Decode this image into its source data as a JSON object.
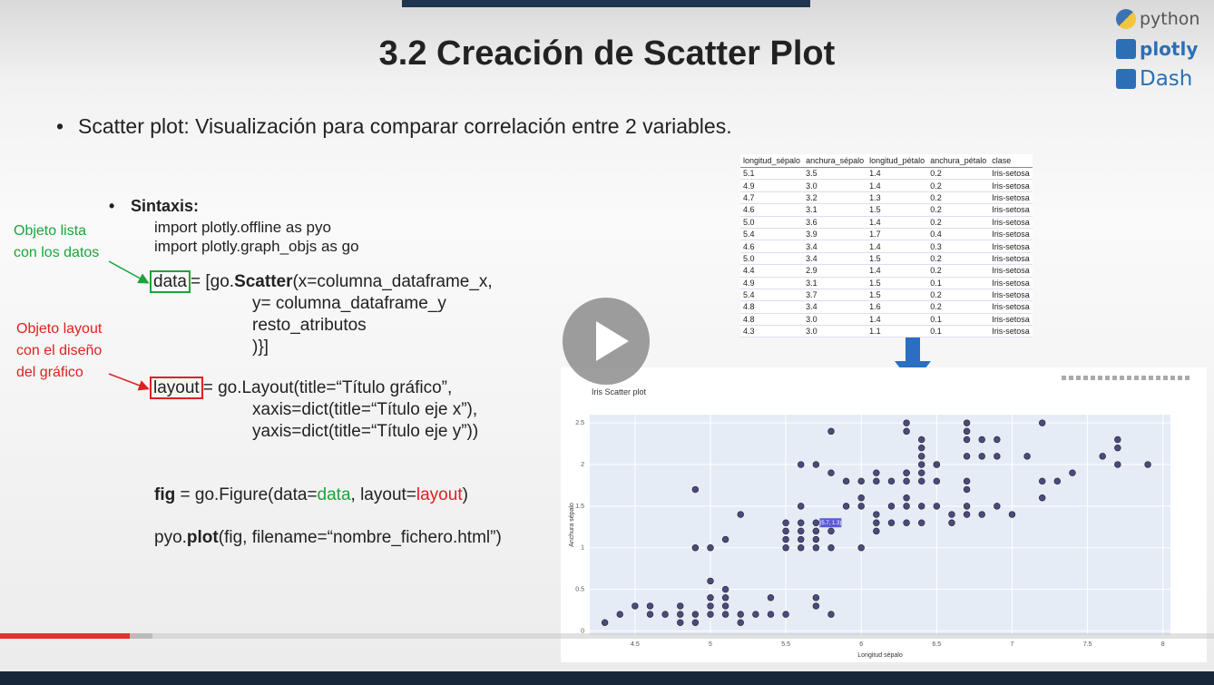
{
  "slide": {
    "title": "3.2 Creación de Scatter Plot",
    "bullet1": "Scatter plot: Visualización para comparar correlación entre 2 variables.",
    "bullet2": "Sintaxis:",
    "code_import1": "import plotly.offline as pyo",
    "code_import2": "import plotly.graph_objs as go",
    "data_kw": "data",
    "data_line1_a": "= [go.",
    "data_line1_b": "Scatter",
    "data_line1_c": "(x=columna_dataframe_x,",
    "data_line2": "y= columna_dataframe_y",
    "data_line3": "resto_atributos",
    "data_line4": ")}]",
    "layout_kw": "layout",
    "layout_line1": "= go.Layout(title=“Título gráfico”,",
    "layout_line2": "xaxis=dict(title=“Título eje x”),",
    "layout_line3": "yaxis=dict(title=“Título eje y”))",
    "fig_a": "fig",
    "fig_b": " = go.Figure(data=",
    "fig_c": "data",
    "fig_d": ", layout=",
    "fig_e": "layout",
    "fig_f": ")",
    "pyo_a": "pyo.",
    "pyo_b": "plot",
    "pyo_c": "(fig, filename=“nombre_fichero.html”)",
    "ann_data_1": "Objeto lista",
    "ann_data_2": "con los datos",
    "ann_layout_1": "Objeto layout",
    "ann_layout_2": "con el diseño",
    "ann_layout_3": "del gráfico"
  },
  "brand": {
    "python": "python",
    "plotly": "plotly",
    "dash": "Dash"
  },
  "table": {
    "headers": [
      "longitud_sépalo",
      "anchura_sépalo",
      "longitud_pétalo",
      "anchura_pétalo",
      "clase"
    ],
    "rows": [
      [
        "5.1",
        "3.5",
        "1.4",
        "0.2",
        "Iris-setosa"
      ],
      [
        "4.9",
        "3.0",
        "1.4",
        "0.2",
        "Iris-setosa"
      ],
      [
        "4.7",
        "3.2",
        "1.3",
        "0.2",
        "Iris-setosa"
      ],
      [
        "4.6",
        "3.1",
        "1.5",
        "0.2",
        "Iris-setosa"
      ],
      [
        "5.0",
        "3.6",
        "1.4",
        "0.2",
        "Iris-setosa"
      ],
      [
        "5.4",
        "3.9",
        "1.7",
        "0.4",
        "Iris-setosa"
      ],
      [
        "4.6",
        "3.4",
        "1.4",
        "0.3",
        "Iris-setosa"
      ],
      [
        "5.0",
        "3.4",
        "1.5",
        "0.2",
        "Iris-setosa"
      ],
      [
        "4.4",
        "2.9",
        "1.4",
        "0.2",
        "Iris-setosa"
      ],
      [
        "4.9",
        "3.1",
        "1.5",
        "0.1",
        "Iris-setosa"
      ],
      [
        "5.4",
        "3.7",
        "1.5",
        "0.2",
        "Iris-setosa"
      ],
      [
        "4.8",
        "3.4",
        "1.6",
        "0.2",
        "Iris-setosa"
      ],
      [
        "4.8",
        "3.0",
        "1.4",
        "0.1",
        "Iris-setosa"
      ],
      [
        "4.3",
        "3.0",
        "1.1",
        "0.1",
        "Iris-setosa"
      ]
    ]
  },
  "colors": {
    "green": "#1aa53a",
    "red": "#e21f1f",
    "marker": "#4b4a7f",
    "plot_bg": "#e5ecf6",
    "progress": "#e0332e"
  },
  "video": {
    "progress": 0.107
  },
  "chart_data": {
    "type": "scatter",
    "title": "Iris Scatter plot",
    "xlabel": "Longitud sépalo",
    "ylabel": "Anchura sépalo",
    "xlim": [
      4.2,
      8.05
    ],
    "ylim": [
      -0.05,
      2.6
    ],
    "xticks": [
      4.5,
      5,
      5.5,
      6,
      6.5,
      7,
      7.5,
      8
    ],
    "yticks": [
      0,
      0.5,
      1,
      1.5,
      2,
      2.5
    ],
    "tick_labels_x": [
      "4.5",
      "5",
      "5.5",
      "6",
      "6.5",
      "7",
      "7.5",
      "8"
    ],
    "tick_labels_y": [
      "0",
      "0.5",
      "1",
      "1.5",
      "2",
      "2.5"
    ],
    "hover_label": "(5.7, 1.3)",
    "hover_point": [
      5.7,
      1.3
    ],
    "points": [
      [
        4.3,
        0.1
      ],
      [
        4.4,
        0.2
      ],
      [
        4.5,
        0.3
      ],
      [
        4.6,
        0.2
      ],
      [
        4.6,
        0.3
      ],
      [
        4.7,
        0.2
      ],
      [
        4.8,
        0.2
      ],
      [
        4.8,
        0.1
      ],
      [
        4.8,
        0.3
      ],
      [
        4.9,
        0.2
      ],
      [
        4.9,
        0.1
      ],
      [
        5.0,
        0.2
      ],
      [
        5.0,
        0.4
      ],
      [
        5.0,
        0.3
      ],
      [
        5.0,
        0.6
      ],
      [
        5.1,
        0.2
      ],
      [
        5.1,
        0.4
      ],
      [
        5.1,
        0.3
      ],
      [
        5.1,
        0.5
      ],
      [
        5.2,
        0.2
      ],
      [
        5.2,
        0.1
      ],
      [
        5.3,
        0.2
      ],
      [
        5.4,
        0.2
      ],
      [
        5.4,
        0.4
      ],
      [
        5.5,
        0.2
      ],
      [
        5.7,
        0.4
      ],
      [
        5.7,
        0.3
      ],
      [
        5.8,
        0.2
      ],
      [
        5.1,
        1.1
      ],
      [
        4.9,
        1.0
      ],
      [
        5.0,
        1.0
      ],
      [
        4.9,
        1.7
      ],
      [
        5.2,
        1.4
      ],
      [
        5.5,
        1.3
      ],
      [
        5.5,
        1.2
      ],
      [
        5.5,
        1.1
      ],
      [
        5.5,
        1.0
      ],
      [
        5.6,
        1.3
      ],
      [
        5.6,
        1.0
      ],
      [
        5.6,
        1.5
      ],
      [
        5.6,
        1.1
      ],
      [
        5.6,
        1.2
      ],
      [
        5.7,
        1.3
      ],
      [
        5.7,
        1.0
      ],
      [
        5.7,
        1.2
      ],
      [
        5.7,
        1.1
      ],
      [
        5.8,
        1.0
      ],
      [
        5.8,
        1.2
      ],
      [
        5.8,
        2.4
      ],
      [
        5.6,
        2.0
      ],
      [
        5.7,
        2.0
      ],
      [
        5.8,
        1.9
      ],
      [
        5.9,
        1.8
      ],
      [
        5.9,
        1.5
      ],
      [
        6.0,
        1.0
      ],
      [
        6.0,
        1.5
      ],
      [
        6.0,
        1.6
      ],
      [
        6.0,
        1.8
      ],
      [
        6.1,
        1.4
      ],
      [
        6.1,
        1.2
      ],
      [
        6.1,
        1.3
      ],
      [
        6.1,
        1.8
      ],
      [
        6.1,
        1.9
      ],
      [
        6.2,
        1.5
      ],
      [
        6.2,
        1.3
      ],
      [
        6.2,
        1.8
      ],
      [
        6.3,
        1.5
      ],
      [
        6.3,
        1.3
      ],
      [
        6.3,
        1.6
      ],
      [
        6.3,
        1.9
      ],
      [
        6.3,
        1.8
      ],
      [
        6.3,
        2.4
      ],
      [
        6.3,
        2.5
      ],
      [
        6.4,
        1.3
      ],
      [
        6.4,
        1.5
      ],
      [
        6.4,
        1.8
      ],
      [
        6.4,
        2.0
      ],
      [
        6.4,
        1.9
      ],
      [
        6.4,
        2.1
      ],
      [
        6.4,
        2.2
      ],
      [
        6.4,
        2.3
      ],
      [
        6.5,
        1.5
      ],
      [
        6.5,
        1.8
      ],
      [
        6.5,
        2.0
      ],
      [
        6.6,
        1.3
      ],
      [
        6.6,
        1.4
      ],
      [
        6.7,
        1.4
      ],
      [
        6.7,
        1.5
      ],
      [
        6.7,
        1.7
      ],
      [
        6.7,
        1.8
      ],
      [
        6.7,
        2.1
      ],
      [
        6.7,
        2.4
      ],
      [
        6.7,
        2.3
      ],
      [
        6.7,
        2.5
      ],
      [
        6.8,
        1.4
      ],
      [
        6.8,
        2.1
      ],
      [
        6.8,
        2.3
      ],
      [
        6.9,
        1.5
      ],
      [
        6.9,
        2.1
      ],
      [
        6.9,
        2.3
      ],
      [
        7.0,
        1.4
      ],
      [
        7.1,
        2.1
      ],
      [
        7.2,
        1.6
      ],
      [
        7.2,
        1.8
      ],
      [
        7.2,
        2.5
      ],
      [
        7.3,
        1.8
      ],
      [
        7.4,
        1.9
      ],
      [
        7.6,
        2.1
      ],
      [
        7.7,
        2.0
      ],
      [
        7.7,
        2.2
      ],
      [
        7.7,
        2.3
      ],
      [
        7.9,
        2.0
      ],
      [
        6.3,
        1.9
      ],
      [
        6.5,
        2.0
      ]
    ]
  }
}
